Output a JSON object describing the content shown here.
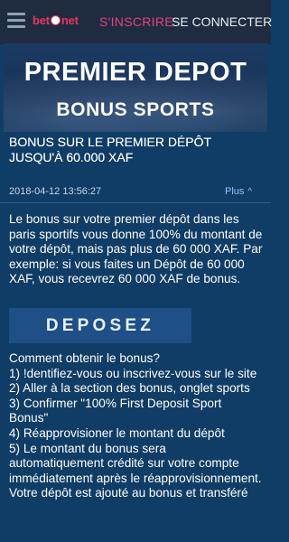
{
  "header": {
    "logo_prefix": "bet",
    "logo_suffix": "net",
    "register_label": "S'INSCRIRE",
    "login_label": "SE CONNECTER",
    "accent_color": "#e5427d"
  },
  "banner": {
    "title": "PREMIER DEPOT",
    "subtitle": "BONUS SPORTS"
  },
  "article": {
    "title": "BONUS SUR LE PREMIER DÉPÔT JUSQU'À 60.000 XAF",
    "date": "2018-04-12 13:56:27",
    "more_label": "Plus",
    "paragraph": "Le bonus sur votre premier dépôt dans les paris sportifs vous donne 100% du montant de votre dépôt, mais pas plus de 60 000 XAF. Par exemple: si vous faites un Dépôt de 60 000 XAF, vous recevrez 60 000 XAF de bonus.",
    "deposit_button": "DEPOSEZ",
    "how_title": "Comment obtenir le bonus?",
    "steps": [
      "1) !dentifiez-vous ou inscrivez-vous sur le site",
      "2) Aller à la section des bonus, onglet sports",
      "3) Confirmer \"100% First Deposit Sport Bonus\"",
      "4) Réapprovisioner le montant du dépôt",
      "5) Le montant du bonus sera automatiquement crédité sur votre compte immédiatement après le réapprovisionnement."
    ],
    "trailing": "Votre dépôt est ajouté au bonus et transféré"
  }
}
